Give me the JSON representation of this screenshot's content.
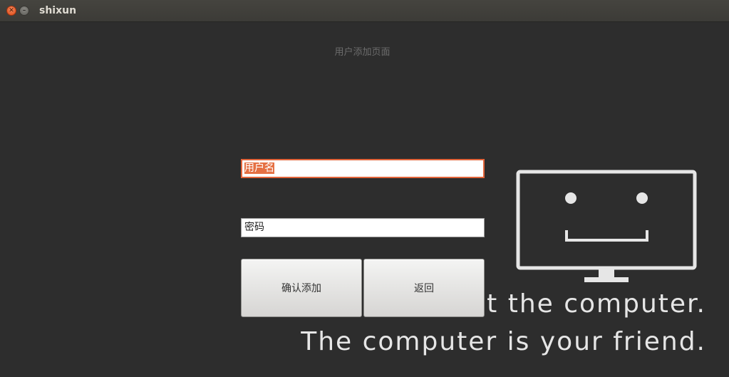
{
  "window": {
    "title": "shixun",
    "controls": {
      "close_icon": "close-icon",
      "minimize_icon": "minimize-icon"
    }
  },
  "page": {
    "title": "用户添加页面"
  },
  "form": {
    "username": {
      "value": "用户名"
    },
    "password": {
      "value": "密码"
    }
  },
  "buttons": {
    "confirm_label": "确认添加",
    "back_label": "返回"
  },
  "wallpaper": {
    "line1": "st the computer.",
    "line2": "The computer is your friend.",
    "icon": "computer-monitor-icon"
  },
  "colors": {
    "background": "#2d2d2d",
    "accent": "#e57043",
    "titlebar": "#3c3b37"
  }
}
